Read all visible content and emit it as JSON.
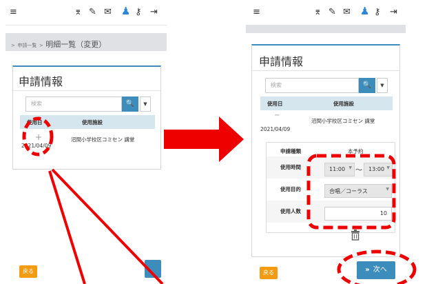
{
  "left_screen": {
    "breadcrumb": {
      "sep1": ">",
      "parent": "申請一覧",
      "sep2": ">",
      "current": "明細一覧（変更）"
    },
    "panel_title": "申請情報",
    "search": {
      "placeholder": "検索",
      "button_icon": "search-icon"
    },
    "table": {
      "headers": [
        "使用日",
        "使用施設"
      ],
      "row": {
        "add_icon": "+",
        "date": "2021/04/09",
        "facility": "沼間小学校区コミセン 講堂"
      }
    },
    "back_label": "戻る"
  },
  "right_screen": {
    "panel_title": "申請情報",
    "search": {
      "placeholder": "検索",
      "button_icon": "search-icon"
    },
    "table": {
      "headers": [
        "使用日",
        "使用施設"
      ],
      "row": {
        "remove_icon": "−",
        "date": "2021/04/09",
        "facility": "沼間小学校区コミセン 講堂"
      }
    },
    "detail": {
      "type_label": "申請種類",
      "type_value": "本予約",
      "time_label": "使用時間",
      "time_from": "11:00",
      "time_sep": "〜",
      "time_to": "13:00",
      "purpose_label": "使用目的",
      "purpose_value": "合唱／コーラス",
      "count_label": "使用人数",
      "count_value": "10"
    },
    "back_label": "戻る",
    "next_label": "次へ",
    "next_icon": "double-chevron-right-icon"
  },
  "colors": {
    "accent": "#3c8dbc",
    "back_button": "#f39c12",
    "annotation": "#ee0000",
    "table_header": "#d6e6ef",
    "gray_bar": "#dfe1e4"
  }
}
